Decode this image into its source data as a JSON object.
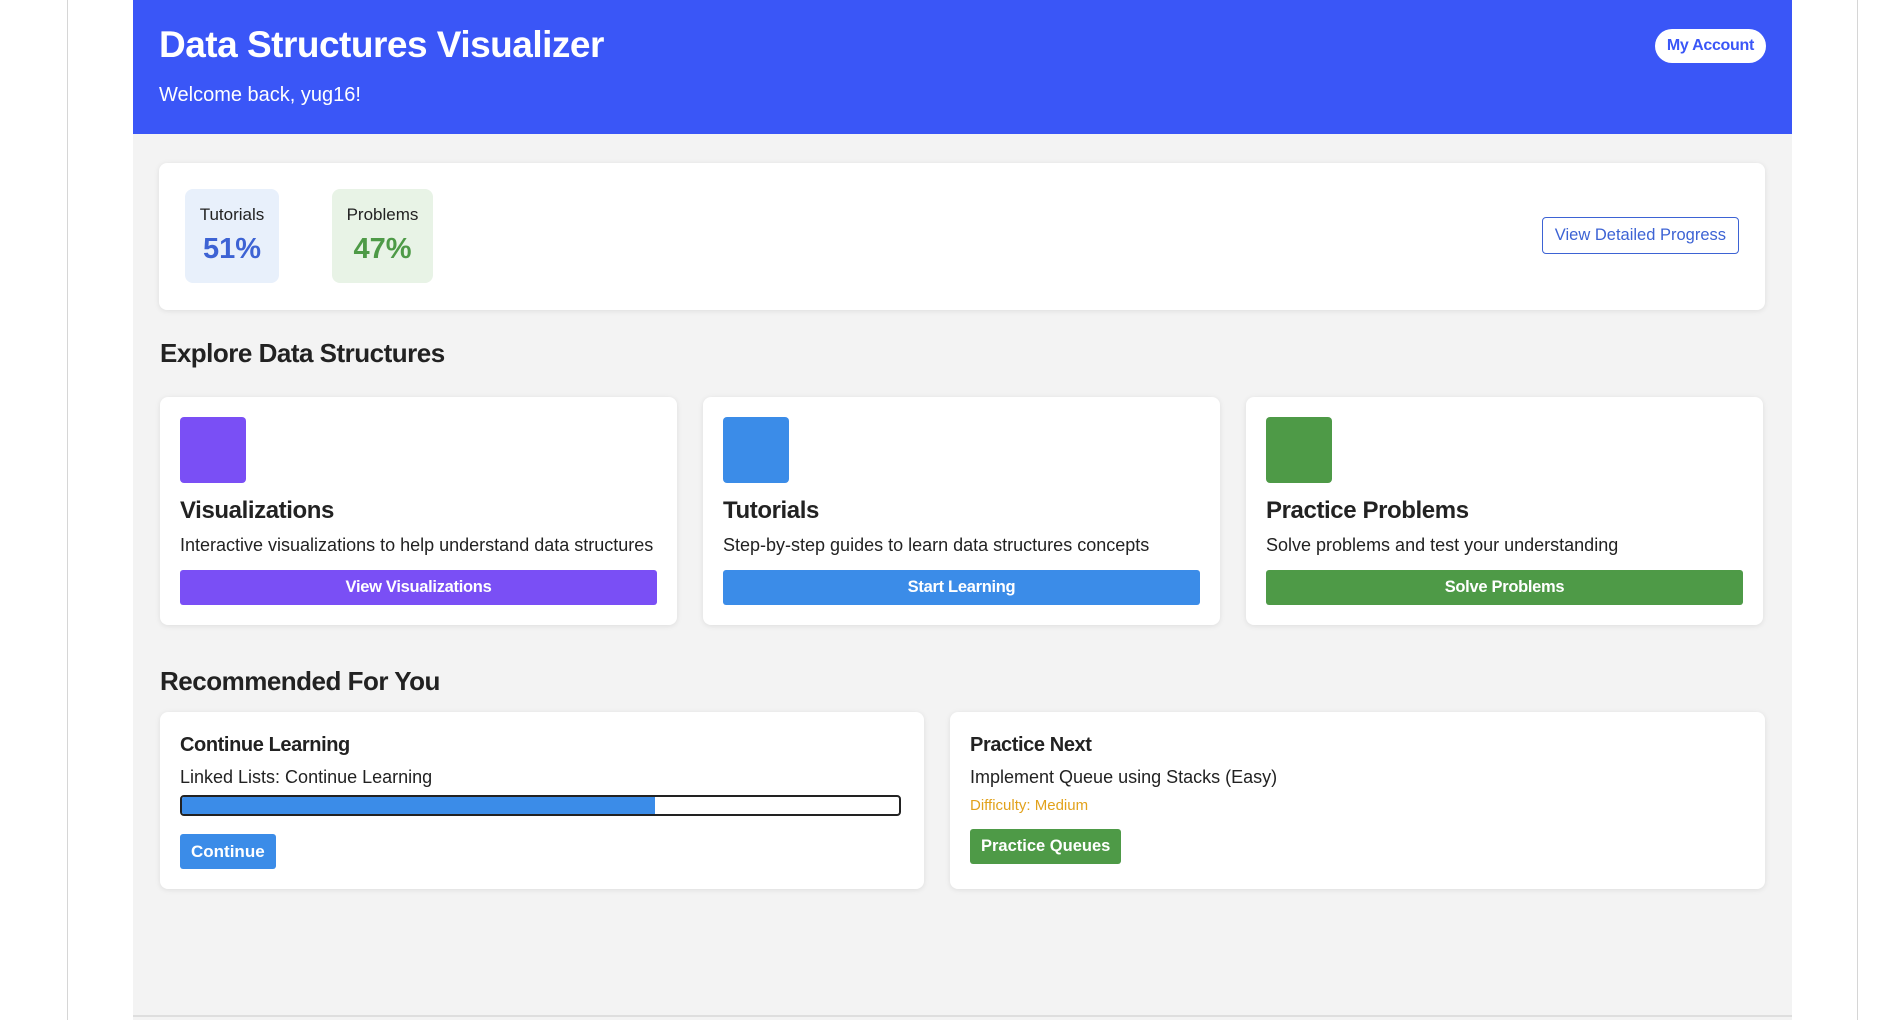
{
  "header": {
    "title": "Data Structures Visualizer",
    "welcome": "Welcome back, yug16!",
    "account_label": "My Account"
  },
  "stats": {
    "tutorials_label": "Tutorials",
    "tutorials_value": "51%",
    "problems_label": "Problems",
    "problems_value": "47%",
    "detailed_progress_label": "View Detailed Progress"
  },
  "explore": {
    "title": "Explore Data Structures",
    "cards": [
      {
        "title": "Visualizations",
        "desc": "Interactive visualizations to help understand data structures",
        "button": "View Visualizations",
        "color": "#7a4ff5"
      },
      {
        "title": "Tutorials",
        "desc": "Step-by-step guides to learn data structures concepts",
        "button": "Start Learning",
        "color": "#3b8ce8"
      },
      {
        "title": "Practice Problems",
        "desc": "Solve problems and test your understanding",
        "button": "Solve Problems",
        "color": "#4e9a47"
      }
    ]
  },
  "recommended": {
    "title": "Recommended For You",
    "continue": {
      "title": "Continue Learning",
      "subtitle": "Linked Lists: Continue Learning",
      "progress": 0.66,
      "button": "Continue"
    },
    "practice": {
      "title": "Practice Next",
      "subtitle": "Implement Queue using Stacks (Easy)",
      "difficulty": "Difficulty: Medium",
      "button": "Practice Queues"
    }
  },
  "colors": {
    "header_bg": "#3a56f7",
    "tutorials_accent": "#3d63d4",
    "problems_accent": "#4e9a47",
    "difficulty": "#e2a21c"
  }
}
